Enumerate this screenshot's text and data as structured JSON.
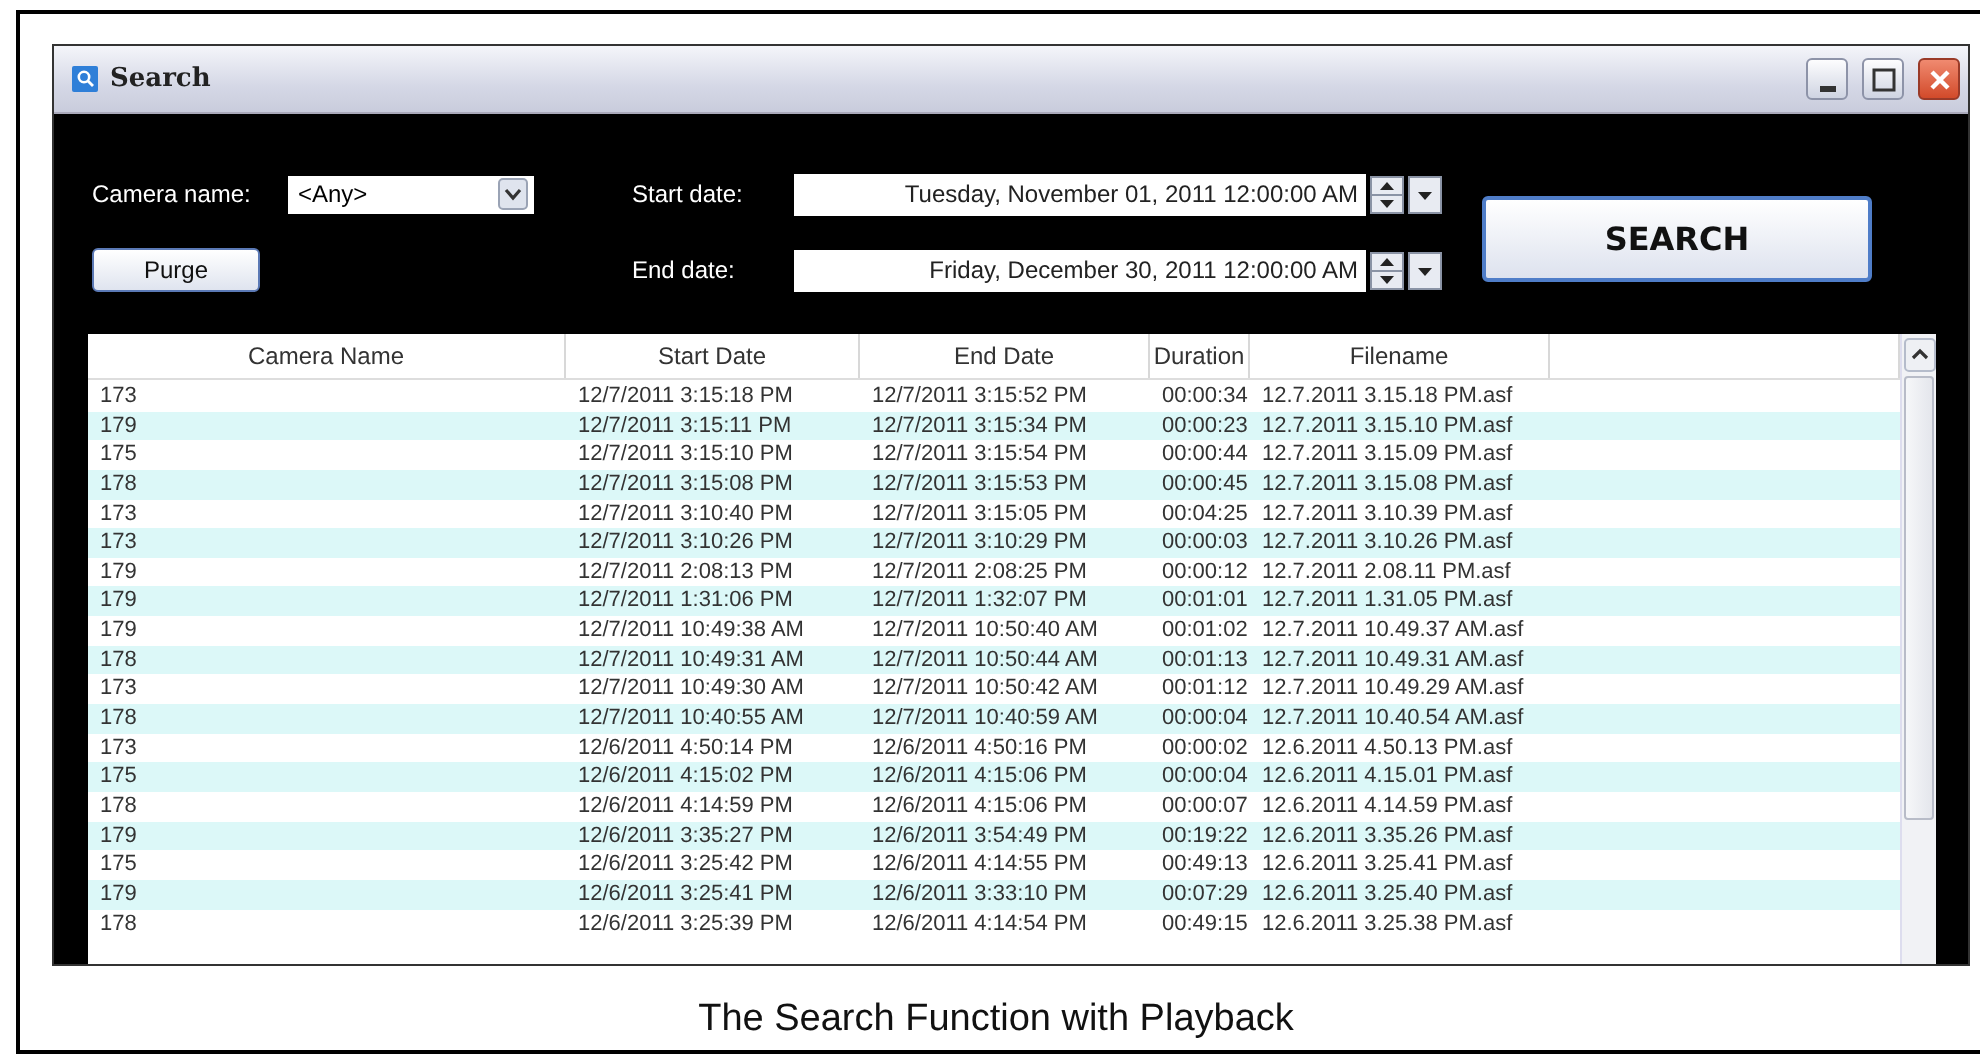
{
  "window": {
    "title": "Search"
  },
  "filters": {
    "camera_label": "Camera name:",
    "camera_value": "<Any>",
    "start_label": "Start date:",
    "start_value": "Tuesday, November 01, 2011 12:00:00 AM",
    "end_label": "End date:",
    "end_value": "Friday, December 30, 2011 12:00:00 AM"
  },
  "buttons": {
    "purge": "Purge",
    "search": "SEARCH"
  },
  "table": {
    "columns": [
      "Camera Name",
      "Start Date",
      "End Date",
      "Duration",
      "Filename"
    ],
    "rows": [
      [
        "173",
        "12/7/2011 3:15:18 PM",
        "12/7/2011 3:15:52 PM",
        "00:00:34",
        "12.7.2011 3.15.18 PM.asf"
      ],
      [
        "179",
        "12/7/2011 3:15:11 PM",
        "12/7/2011 3:15:34 PM",
        "00:00:23",
        "12.7.2011 3.15.10 PM.asf"
      ],
      [
        "175",
        "12/7/2011 3:15:10 PM",
        "12/7/2011 3:15:54 PM",
        "00:00:44",
        "12.7.2011 3.15.09 PM.asf"
      ],
      [
        "178",
        "12/7/2011 3:15:08 PM",
        "12/7/2011 3:15:53 PM",
        "00:00:45",
        "12.7.2011 3.15.08 PM.asf"
      ],
      [
        "173",
        "12/7/2011 3:10:40 PM",
        "12/7/2011 3:15:05 PM",
        "00:04:25",
        "12.7.2011 3.10.39 PM.asf"
      ],
      [
        "173",
        "12/7/2011 3:10:26 PM",
        "12/7/2011 3:10:29 PM",
        "00:00:03",
        "12.7.2011 3.10.26 PM.asf"
      ],
      [
        "179",
        "12/7/2011 2:08:13 PM",
        "12/7/2011 2:08:25 PM",
        "00:00:12",
        "12.7.2011 2.08.11 PM.asf"
      ],
      [
        "179",
        "12/7/2011 1:31:06 PM",
        "12/7/2011 1:32:07 PM",
        "00:01:01",
        "12.7.2011 1.31.05 PM.asf"
      ],
      [
        "179",
        "12/7/2011 10:49:38 AM",
        "12/7/2011 10:50:40 AM",
        "00:01:02",
        "12.7.2011 10.49.37 AM.asf"
      ],
      [
        "178",
        "12/7/2011 10:49:31 AM",
        "12/7/2011 10:50:44 AM",
        "00:01:13",
        "12.7.2011 10.49.31 AM.asf"
      ],
      [
        "173",
        "12/7/2011 10:49:30 AM",
        "12/7/2011 10:50:42 AM",
        "00:01:12",
        "12.7.2011 10.49.29 AM.asf"
      ],
      [
        "178",
        "12/7/2011 10:40:55 AM",
        "12/7/2011 10:40:59 AM",
        "00:00:04",
        "12.7.2011 10.40.54 AM.asf"
      ],
      [
        "173",
        "12/6/2011 4:50:14 PM",
        "12/6/2011 4:50:16 PM",
        "00:00:02",
        "12.6.2011 4.50.13 PM.asf"
      ],
      [
        "175",
        "12/6/2011 4:15:02 PM",
        "12/6/2011 4:15:06 PM",
        "00:00:04",
        "12.6.2011 4.15.01 PM.asf"
      ],
      [
        "178",
        "12/6/2011 4:14:59 PM",
        "12/6/2011 4:15:06 PM",
        "00:00:07",
        "12.6.2011 4.14.59 PM.asf"
      ],
      [
        "179",
        "12/6/2011 3:35:27 PM",
        "12/6/2011 3:54:49 PM",
        "00:19:22",
        "12.6.2011 3.35.26 PM.asf"
      ],
      [
        "175",
        "12/6/2011 3:25:42 PM",
        "12/6/2011 4:14:55 PM",
        "00:49:13",
        "12.6.2011 3.25.41 PM.asf"
      ],
      [
        "179",
        "12/6/2011 3:25:41 PM",
        "12/6/2011 3:33:10 PM",
        "00:07:29",
        "12.6.2011 3.25.40 PM.asf"
      ],
      [
        "178",
        "12/6/2011 3:25:39 PM",
        "12/6/2011 4:14:54 PM",
        "00:49:15",
        "12.6.2011 3.25.38 PM.asf"
      ]
    ]
  },
  "caption": "The Search Function with Playback"
}
